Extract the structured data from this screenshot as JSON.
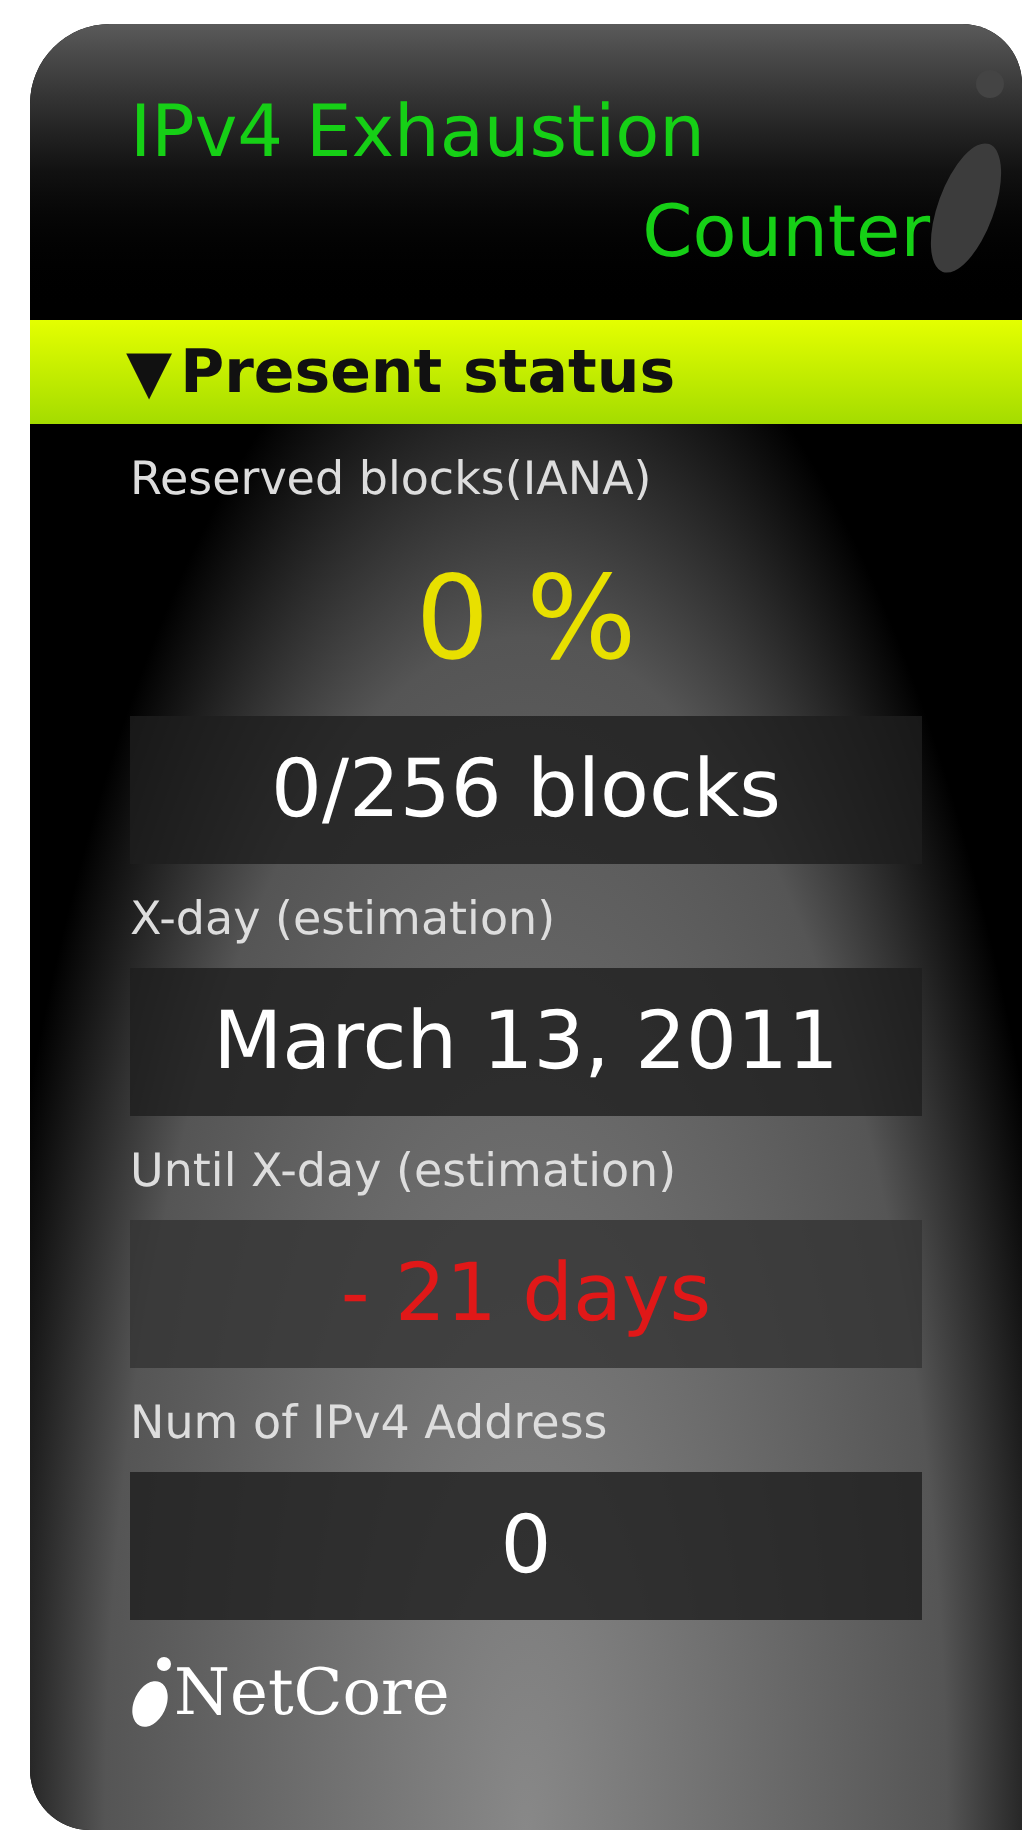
{
  "title_lines": [
    "IPv4 Exhaustion",
    "Counter"
  ],
  "section": {
    "toggle": "▼",
    "label": "Present status"
  },
  "fields": [
    {
      "label": "Reserved blocks(IANA)",
      "values": [
        {
          "kind": "percent",
          "text": "0 %"
        },
        {
          "kind": "box",
          "text": "0/256 blocks"
        }
      ]
    },
    {
      "label": "X-day (estimation)",
      "values": [
        {
          "kind": "box",
          "text": "March 13, 2011"
        }
      ]
    },
    {
      "label": "Until X-day (estimation)",
      "values": [
        {
          "kind": "alert",
          "text": "- 21 days"
        }
      ]
    },
    {
      "label": "Num of IPv4 Address",
      "values": [
        {
          "kind": "box",
          "text": "0"
        }
      ]
    }
  ],
  "footer": {
    "brand": "NetCore"
  }
}
